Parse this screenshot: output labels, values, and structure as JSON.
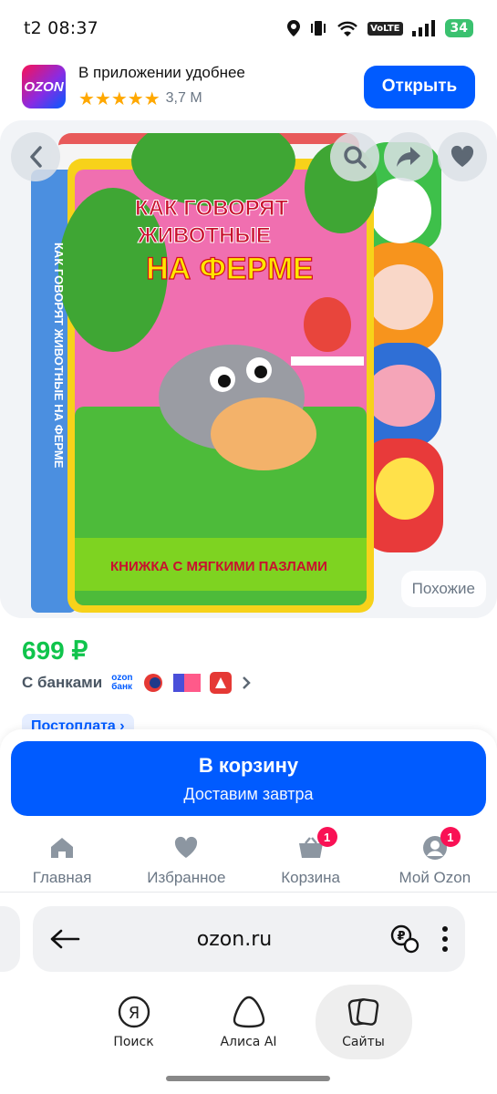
{
  "status": {
    "time": "t2 08:37",
    "volte": "VoLTE",
    "battery": "34"
  },
  "banner": {
    "logo": "OZON",
    "title": "В приложении удобнее",
    "stars": "★★★★★",
    "rating": "3,7 М",
    "open_label": "Открыть"
  },
  "gallery": {
    "similar_label": "Похожие",
    "book_title_line1": "КАК ГОВОРЯТ",
    "book_title_line2": "ЖИВОТНЫЕ",
    "book_title_line3": "НА ФЕРМЕ",
    "book_subtitle": "КНИЖКА С МЯГКИМИ ПАЗЛАМИ",
    "spine_text": "КАК ГОВОРЯТ ЖИВОТНЫЕ НА ФЕРМЕ"
  },
  "product": {
    "price": "699 ₽",
    "banks_label": "С банками",
    "ozon_bank_line1": "ozon",
    "ozon_bank_line2": "банк",
    "postpay_label": "Постоплата"
  },
  "cart": {
    "main_label": "В корзину",
    "sub_label": "Доставим завтра"
  },
  "tabs": [
    {
      "label": "Главная",
      "icon": "home-icon"
    },
    {
      "label": "Избранное",
      "icon": "heart-icon"
    },
    {
      "label": "Корзина",
      "icon": "cart-icon",
      "badge": "1"
    },
    {
      "label": "Мой Ozon",
      "icon": "profile-icon",
      "badge": "1"
    }
  ],
  "browser": {
    "url": "ozon.ru",
    "nav": [
      {
        "label": "Поиск",
        "icon": "yandex-search-icon"
      },
      {
        "label": "Алиса AI",
        "icon": "alice-icon"
      },
      {
        "label": "Сайты",
        "icon": "sites-icon"
      }
    ]
  },
  "colors": {
    "accent": "#005bff",
    "price": "#10c44c",
    "badge": "#f91155"
  }
}
